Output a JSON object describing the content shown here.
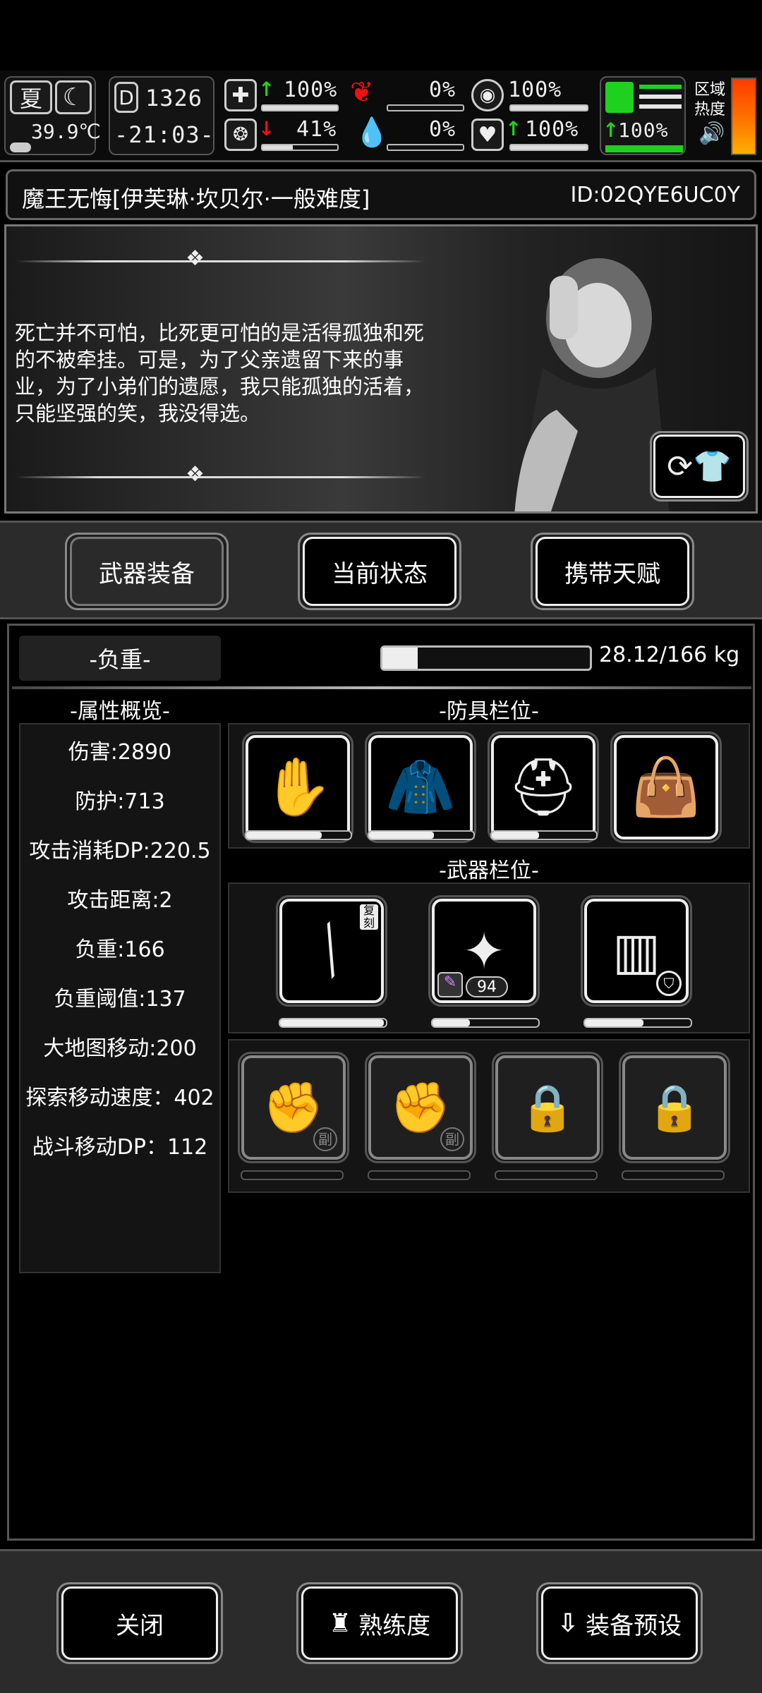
{
  "hud": {
    "season": "夏",
    "temperature": "39.9℃",
    "day": "1326",
    "day_icon_letter": "D",
    "clock": "-21:03-",
    "stats": [
      {
        "icon": "medkit-icon",
        "value": "100%",
        "arrow": "up",
        "fill": 1.0
      },
      {
        "icon": "stomach-icon",
        "value": "0%",
        "arrow": "",
        "fill": 0.0
      },
      {
        "icon": "capsule-icon",
        "value": "100%",
        "arrow": "",
        "fill": 1.0
      },
      {
        "icon": "brain-icon",
        "value": "41%",
        "arrow": "down",
        "fill": 0.41
      },
      {
        "icon": "blood-drop-icon",
        "value": "0%",
        "arrow": "",
        "fill": 0.0
      },
      {
        "icon": "heart-icon",
        "value": "100%",
        "arrow": "up",
        "fill": 1.0
      }
    ],
    "stamina_value": "100%",
    "region_heat_label_1": "区域",
    "region_heat_label_2": "热度",
    "colors": {
      "accent_green": "#1fd11f",
      "alert_red": "#e11111"
    }
  },
  "title": {
    "character": "魔王无悔[伊芙琳·坎贝尔·一般难度]",
    "id": "ID:02QYE6UC0Y"
  },
  "portrait": {
    "quote": "死亡并不可怕，比死更可怕的是活得孤独和死的不被牵挂。可是，为了父亲遗留下来的事业，为了小弟们的遗愿，我只能孤独的活着，只能坚强的笑，我没得选。"
  },
  "tabs": [
    "武器装备",
    "当前状态",
    "携带天赋"
  ],
  "active_tab": 0,
  "load": {
    "label": "-负重-",
    "value": "28.12/166 kg",
    "fill": 0.17
  },
  "attributes": {
    "header": "-属性概览-",
    "items": [
      "伤害:2890",
      "防护:713",
      "攻击消耗DP:220.5",
      "攻击距离:2",
      "负重:166",
      "负重阈值:137",
      "大地图移动:200",
      "探索移动速度：402",
      "战斗移动DP：112"
    ]
  },
  "armor": {
    "header": "-防具栏位-",
    "slots": [
      {
        "icon": "gloves-icon",
        "durability": 0.72
      },
      {
        "icon": "coat-icon",
        "durability": 0.62
      },
      {
        "icon": "helmet-icon",
        "durability": 0.45
      },
      {
        "icon": "bag-icon",
        "durability": null
      }
    ]
  },
  "weapons": {
    "header": "-武器栏位-",
    "slots": [
      {
        "icon": "spear-icon",
        "badge": "复刻",
        "durability": 0.98
      },
      {
        "icon": "gun-icon",
        "ammo": "94",
        "durability": 0.35
      },
      {
        "icon": "shield-pack-icon",
        "durability": 0.55
      }
    ],
    "sub_slots": [
      {
        "icon": "fist-icon",
        "badge": "副",
        "locked": false
      },
      {
        "icon": "fist-icon",
        "badge": "副",
        "locked": false
      },
      {
        "icon": "lock-icon",
        "locked": true
      },
      {
        "icon": "lock-icon",
        "locked": true
      }
    ]
  },
  "bottom": {
    "close": "关闭",
    "proficiency": "熟练度",
    "preset": "装备预设"
  }
}
